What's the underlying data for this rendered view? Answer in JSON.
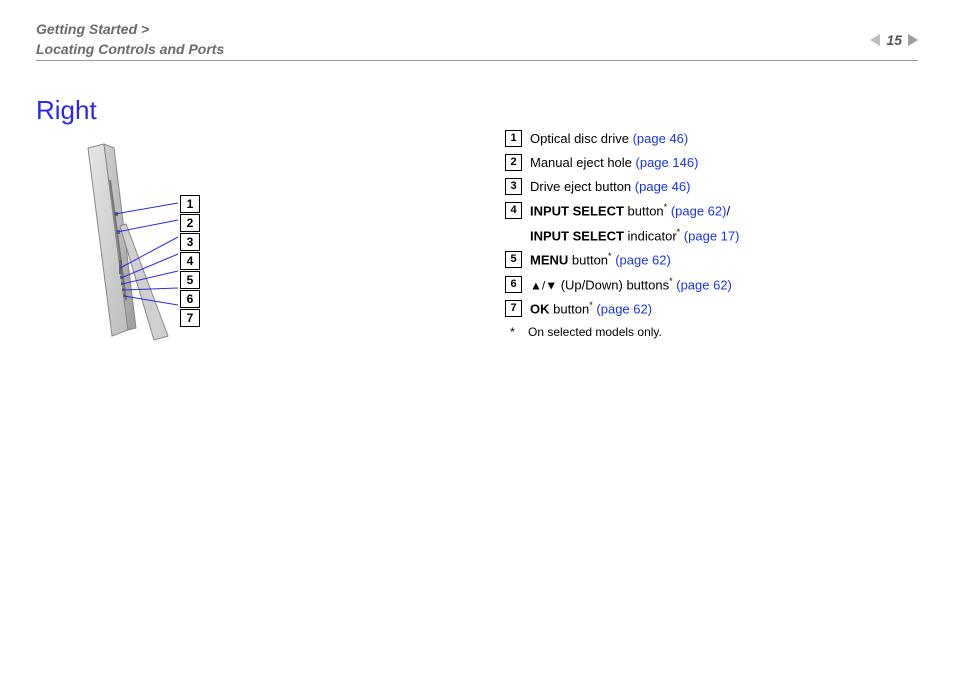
{
  "header": {
    "breadcrumb_line1": "Getting Started >",
    "breadcrumb_line2": "Locating Controls and Ports",
    "page_number": "15"
  },
  "section": {
    "title": "Right"
  },
  "diagram": {
    "callouts": [
      "1",
      "2",
      "3",
      "4",
      "5",
      "6",
      "7"
    ]
  },
  "list": {
    "items": [
      {
        "num": "1",
        "parts": [
          {
            "text": "Optical disc drive ",
            "bold": false,
            "link": false
          },
          {
            "text": "(page 46)",
            "bold": false,
            "link": true
          }
        ]
      },
      {
        "num": "2",
        "parts": [
          {
            "text": "Manual eject hole ",
            "bold": false,
            "link": false
          },
          {
            "text": "(page 146)",
            "bold": false,
            "link": true
          }
        ]
      },
      {
        "num": "3",
        "parts": [
          {
            "text": "Drive eject button ",
            "bold": false,
            "link": false
          },
          {
            "text": "(page 46)",
            "bold": false,
            "link": true
          }
        ]
      },
      {
        "num": "4",
        "parts": [
          {
            "text": "INPUT SELECT",
            "bold": true,
            "link": false
          },
          {
            "text": " button",
            "bold": false,
            "link": false
          },
          {
            "text": "*",
            "bold": false,
            "link": false,
            "sup": true
          },
          {
            "text": " ",
            "bold": false,
            "link": false
          },
          {
            "text": "(page 62)",
            "bold": false,
            "link": true
          },
          {
            "text": "/",
            "bold": false,
            "link": false
          }
        ],
        "line2": [
          {
            "text": "INPUT SELECT",
            "bold": true,
            "link": false
          },
          {
            "text": " indicator",
            "bold": false,
            "link": false
          },
          {
            "text": "*",
            "bold": false,
            "link": false,
            "sup": true
          },
          {
            "text": " ",
            "bold": false,
            "link": false
          },
          {
            "text": "(page 17)",
            "bold": false,
            "link": true
          }
        ]
      },
      {
        "num": "5",
        "parts": [
          {
            "text": "MENU",
            "bold": true,
            "link": false
          },
          {
            "text": " button",
            "bold": false,
            "link": false
          },
          {
            "text": "*",
            "bold": false,
            "link": false,
            "sup": true
          },
          {
            "text": " ",
            "bold": false,
            "link": false
          },
          {
            "text": "(page 62)",
            "bold": false,
            "link": true
          }
        ]
      },
      {
        "num": "6",
        "parts": [
          {
            "text": "♠/♦ (Up/Down) buttons",
            "bold": false,
            "link": false,
            "arrows": true
          },
          {
            "text": "*",
            "bold": false,
            "link": false,
            "sup": true
          },
          {
            "text": " ",
            "bold": false,
            "link": false
          },
          {
            "text": "(page 62)",
            "bold": false,
            "link": true
          }
        ]
      },
      {
        "num": "7",
        "parts": [
          {
            "text": "OK",
            "bold": true,
            "link": false
          },
          {
            "text": " button",
            "bold": false,
            "link": false
          },
          {
            "text": "*",
            "bold": false,
            "link": false,
            "sup": true
          },
          {
            "text": " ",
            "bold": false,
            "link": false
          },
          {
            "text": "(page 62)",
            "bold": false,
            "link": true
          }
        ]
      }
    ],
    "footnote": {
      "marker": "*",
      "text": "On selected models only."
    }
  }
}
